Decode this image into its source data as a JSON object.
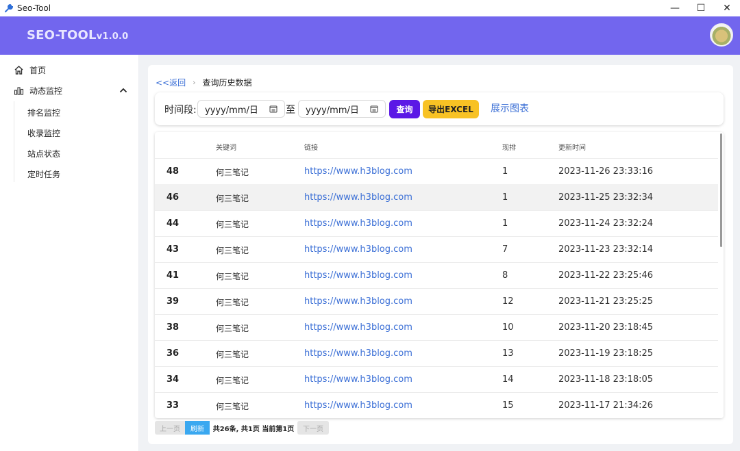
{
  "window": {
    "title": "Seo-Tool",
    "controls": [
      "—",
      "☐",
      "✕"
    ]
  },
  "header": {
    "brand": "SEO-TOOL",
    "version": "v1.0.0"
  },
  "sidebar": {
    "home": "首页",
    "monitor": "动态监控",
    "subitems": [
      "排名监控",
      "收录监控",
      "站点状态",
      "定时任务"
    ]
  },
  "breadcrumb": {
    "back": "<<返回",
    "current": "查询历史数据"
  },
  "filter": {
    "label": "时间段:",
    "date_from_placeholder": "yyyy/mm/日",
    "to_label": "至",
    "date_to_placeholder": "yyyy/mm/日",
    "query_button": "查询",
    "export_button": "导出EXCEL",
    "chart_link": "展示图表"
  },
  "table": {
    "headers": {
      "id": "",
      "keyword": "关键词",
      "link": "链接",
      "rank": "现排",
      "updated": "更新时间"
    },
    "rows": [
      {
        "id": "48",
        "keyword": "何三笔记",
        "link": "https://www.h3blog.com",
        "rank": "1",
        "updated": "2023-11-26 23:33:16"
      },
      {
        "id": "46",
        "keyword": "何三笔记",
        "link": "https://www.h3blog.com",
        "rank": "1",
        "updated": "2023-11-25 23:32:34"
      },
      {
        "id": "44",
        "keyword": "何三笔记",
        "link": "https://www.h3blog.com",
        "rank": "1",
        "updated": "2023-11-24 23:32:24"
      },
      {
        "id": "43",
        "keyword": "何三笔记",
        "link": "https://www.h3blog.com",
        "rank": "7",
        "updated": "2023-11-23 23:32:14"
      },
      {
        "id": "41",
        "keyword": "何三笔记",
        "link": "https://www.h3blog.com",
        "rank": "8",
        "updated": "2023-11-22 23:25:46"
      },
      {
        "id": "39",
        "keyword": "何三笔记",
        "link": "https://www.h3blog.com",
        "rank": "12",
        "updated": "2023-11-21 23:25:25"
      },
      {
        "id": "38",
        "keyword": "何三笔记",
        "link": "https://www.h3blog.com",
        "rank": "10",
        "updated": "2023-11-20 23:18:45"
      },
      {
        "id": "36",
        "keyword": "何三笔记",
        "link": "https://www.h3blog.com",
        "rank": "13",
        "updated": "2023-11-19 23:18:25"
      },
      {
        "id": "34",
        "keyword": "何三笔记",
        "link": "https://www.h3blog.com",
        "rank": "14",
        "updated": "2023-11-18 23:18:05"
      },
      {
        "id": "33",
        "keyword": "何三笔记",
        "link": "https://www.h3blog.com",
        "rank": "15",
        "updated": "2023-11-17 21:34:26"
      }
    ]
  },
  "pagination": {
    "prev": "上一页",
    "refresh": "刷新",
    "info": "共26条, 共1页 当前第1页",
    "next": "下一页"
  },
  "colors": {
    "header_bg": "#7266ee",
    "query_button": "#5b18e6",
    "export_button": "#f8c224",
    "link": "#3b6fd6",
    "refresh_button": "#3aa8f0"
  }
}
